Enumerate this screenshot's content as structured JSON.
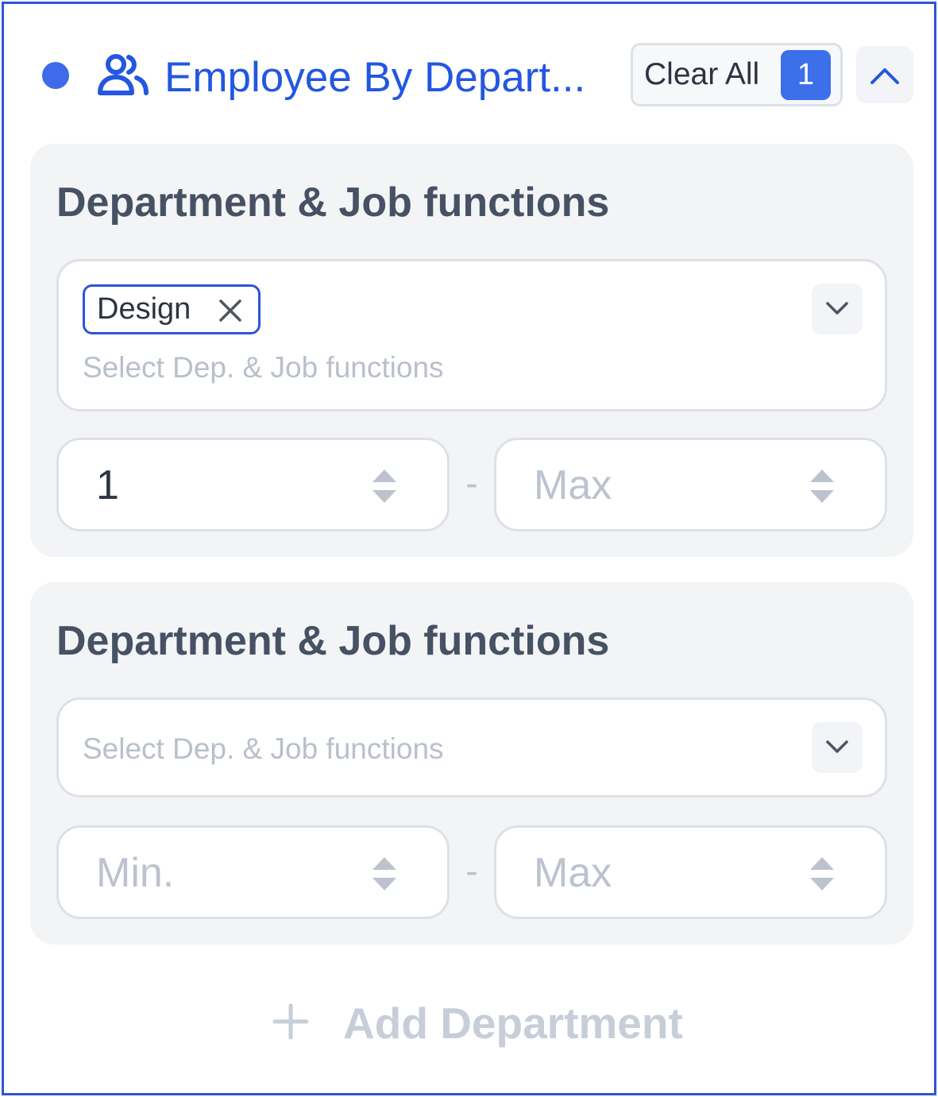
{
  "header": {
    "title": "Employee By Depart...",
    "icon": "users-icon",
    "status_color": "#3d6bea",
    "clear_all_label": "Clear All",
    "active_count": "1",
    "collapse_icon": "chevron-up-icon"
  },
  "filters": [
    {
      "title": "Department & Job functions",
      "selected_tags": [
        "Design"
      ],
      "placeholder": "Select Dep. & Job functions",
      "min_value": "1",
      "min_placeholder": "",
      "max_value": "",
      "max_placeholder": "Max",
      "separator": "-"
    },
    {
      "title": "Department & Job functions",
      "selected_tags": [],
      "placeholder": "Select Dep. & Job functions",
      "min_value": "",
      "min_placeholder": "Min.",
      "max_value": "",
      "max_placeholder": "Max",
      "separator": "-"
    }
  ],
  "add_department": {
    "label": "Add Department",
    "icon": "plus-icon"
  },
  "colors": {
    "accent": "#2357e0",
    "badge": "#3c6fea",
    "frame_border": "#2d55d6",
    "card_bg": "#f3f4f6"
  }
}
